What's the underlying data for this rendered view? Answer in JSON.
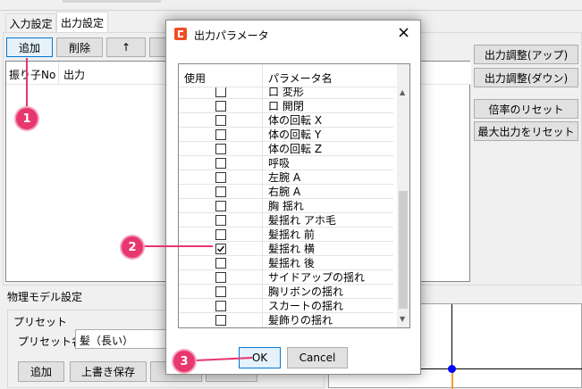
{
  "tabs": [
    {
      "label": "入力設定",
      "active": false
    },
    {
      "label": "出力設定",
      "active": true
    }
  ],
  "toolbar": {
    "add": "追加",
    "delete": "削除",
    "up": "↑"
  },
  "output_table": {
    "headers": [
      "振り子No",
      "出力"
    ]
  },
  "right_buttons": {
    "adjust_up": "出力調整(アップ)",
    "adjust_down": "出力調整(ダウン)",
    "reset_scale": "倍率のリセット",
    "reset_max": "最大出力をリセット"
  },
  "physics": {
    "section_title": "物理モデル設定",
    "preset_group": "プリセット",
    "preset_label": "プリセット名：",
    "preset_value": "髪（長い）",
    "buttons": {
      "add": "追加",
      "overwrite": "上書き保存"
    }
  },
  "dialog": {
    "title": "出力パラメータ",
    "col_use": "使用",
    "col_name": "パラメータ名",
    "rows": [
      {
        "name": "口 変形",
        "checked": false
      },
      {
        "name": "口 開閉",
        "checked": false
      },
      {
        "name": "体の回転 X",
        "checked": false
      },
      {
        "name": "体の回転 Y",
        "checked": false
      },
      {
        "name": "体の回転 Z",
        "checked": false
      },
      {
        "name": "呼吸",
        "checked": false
      },
      {
        "name": "左腕 A",
        "checked": false
      },
      {
        "name": "右腕 A",
        "checked": false
      },
      {
        "name": "胸 揺れ",
        "checked": false
      },
      {
        "name": "髪揺れ アホ毛",
        "checked": false
      },
      {
        "name": "髪揺れ 前",
        "checked": false
      },
      {
        "name": "髪揺れ 横",
        "checked": true
      },
      {
        "name": "髪揺れ 後",
        "checked": false
      },
      {
        "name": "サイドアップの揺れ",
        "checked": false
      },
      {
        "name": "胸リボンの揺れ",
        "checked": false
      },
      {
        "name": "スカートの揺れ",
        "checked": false
      },
      {
        "name": "髪飾りの揺れ",
        "checked": false
      }
    ],
    "ok": "OK",
    "cancel": "Cancel"
  },
  "callouts": [
    "1",
    "2",
    "3"
  ],
  "colors": {
    "callout": "#e8366e",
    "accent": "#0078d7",
    "app_icon": "#f04e23"
  }
}
